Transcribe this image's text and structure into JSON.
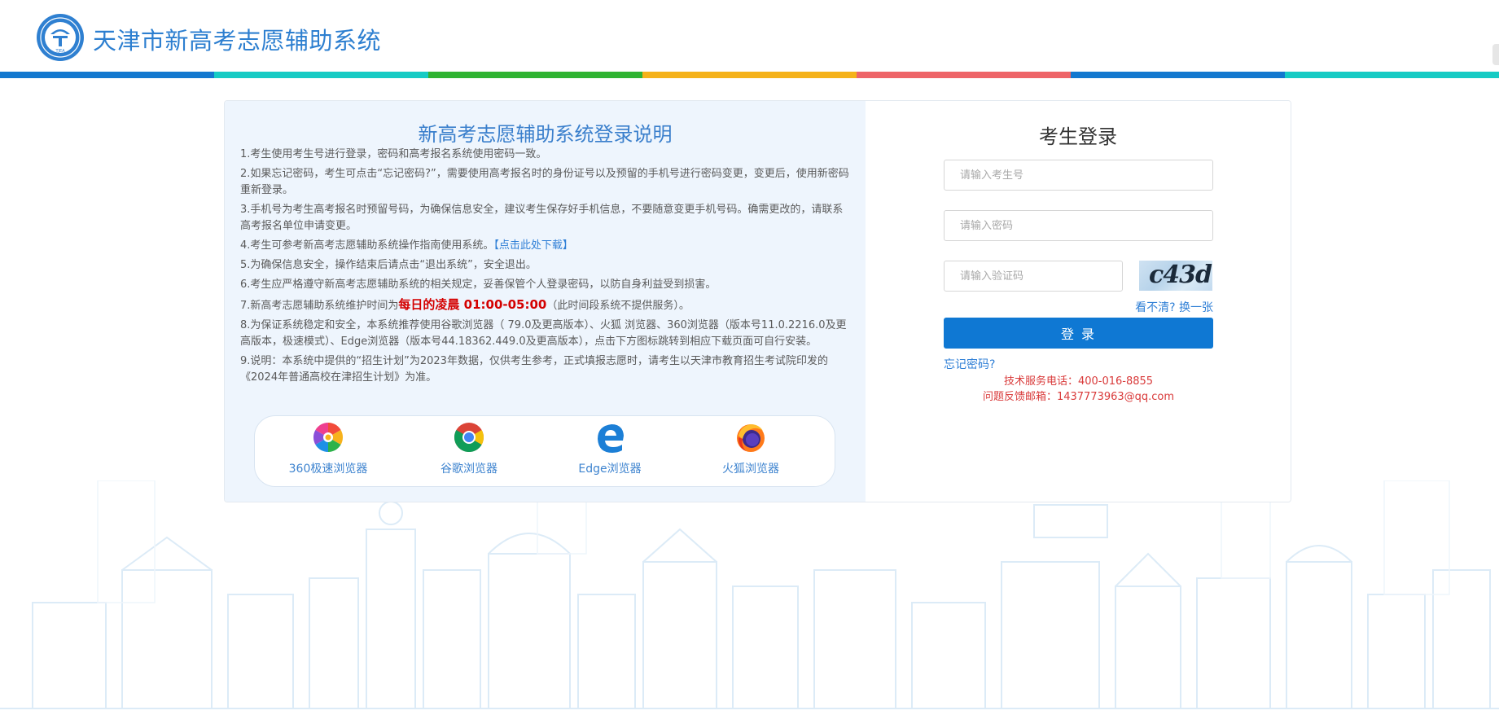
{
  "header": {
    "title": "天津市新高考志愿辅助系统",
    "logo_text": "TJEA",
    "strip_colors": [
      "#1378cf",
      "#16cbc4",
      "#2fb332",
      "#f5b21a",
      "#ee6468",
      "#1378cf",
      "#16cbc4"
    ]
  },
  "info": {
    "title": "新高考志愿辅助系统登录说明",
    "rule1": "1.考生使用考生号进行登录，密码和高考报名系统使用密码一致。",
    "rule2": "2.如果忘记密码，考生可点击“忘记密码?”，需要使用高考报名时的身份证号以及预留的手机号进行密码变更，变更后，使用新密码重新登录。",
    "rule3": "3.手机号为考生高考报名时预留号码，为确保信息安全，建议考生保存好手机信息，不要随意变更手机号码。确需更改的，请联系高考报名单位申请变更。",
    "rule4_text": "4.考生可参考新高考志愿辅助系统操作指南使用系统。",
    "rule4_link": "【点击此处下载】",
    "rule5": "5.为确保信息安全，操作结束后请点击“退出系统”，安全退出。",
    "rule6": "6.考生应严格遵守新高考志愿辅助系统的相关规定，妥善保管个人登录密码，以防自身利益受到损害。",
    "rule7_pre": "7.新高考志愿辅助系统维护时间为",
    "rule7_hl": "每日的凌晨 01:00-05:00",
    "rule7_post": "（此时间段系统不提供服务）。",
    "rule8": "8.为保证系统稳定和安全，本系统推荐使用谷歌浏览器（ 79.0及更高版本）、火狐 浏览器、360浏览器（版本号11.0.2216.0及更高版本，极速模式）、Edge浏览器（版本号44.18362.449.0及更高版本），点击下方图标跳转到相应下载页面可自行安装。",
    "rule9": "9.说明：本系统中提供的“招生计划”为2023年数据，仅供考生参考，正式填报志愿时，请考生以天津市教育招生考试院印发的《2024年普通高校在津招生计划》为准。"
  },
  "browsers": [
    {
      "name": "360极速浏览器",
      "icon": "360-browser-icon"
    },
    {
      "name": "谷歌浏览器",
      "icon": "chrome-icon"
    },
    {
      "name": "Edge浏览器",
      "icon": "edge-icon"
    },
    {
      "name": "火狐浏览器",
      "icon": "firefox-icon"
    }
  ],
  "login": {
    "title": "考生登录",
    "username_placeholder": "请输入考生号",
    "password_placeholder": "请输入密码",
    "captcha_placeholder": "请输入验证码",
    "captcha_text": "c43d",
    "refresh_text": "看不清? 换一张",
    "login_button": "登 录",
    "forgot_password": "忘记密码?",
    "service_phone": "技术服务电话：400-016-8855",
    "feedback_email": "问题反馈邮箱：1437773963@qq.com"
  },
  "colors": {
    "accent": "#0f78d3",
    "title_blue": "#3a7fcc",
    "contact_red": "#d93a3a",
    "left_panel_bg": "#eef5fd"
  }
}
